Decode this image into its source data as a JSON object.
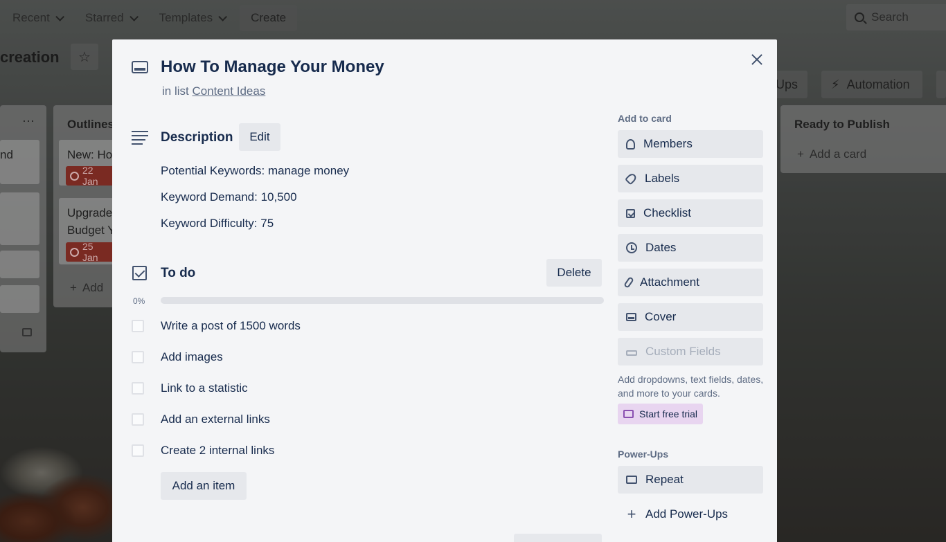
{
  "topbar": {
    "recent": "Recent",
    "starred": "Starred",
    "templates": "Templates",
    "create": "Create",
    "search": "Search"
  },
  "board": {
    "title": "creation",
    "powerups_btn": "-Ups",
    "automation_btn": "Automation",
    "left_list": {
      "menu": "···",
      "card1": "nd"
    },
    "outlines_list": {
      "title": "Outlines",
      "card1": "New: Ho",
      "card1_due": "22 Jan",
      "card2_line1": "Upgrade",
      "card2_line2": "Budget Y",
      "card2_due": "25 Jan",
      "add": "Add"
    },
    "ready_list": {
      "title": "Ready to Publish",
      "add": "Add a card"
    }
  },
  "card": {
    "title": "How To Manage Your Money",
    "in_list_prefix": "in list",
    "list_name": "Content Ideas"
  },
  "description": {
    "title": "Description",
    "edit": "Edit",
    "lines": [
      "Potential Keywords: manage money",
      "Keyword Demand: 10,500",
      "Keyword Difficulty: 75"
    ]
  },
  "checklist": {
    "title": "To do",
    "delete": "Delete",
    "percent": "0%",
    "progress": 0,
    "items": [
      "Write a post of 1500 words",
      "Add images",
      "Link to a statistic",
      "Add an external links",
      "Create 2 internal links"
    ],
    "add_item": "Add an item"
  },
  "sidebar": {
    "add_to_card": "Add to card",
    "buttons": {
      "members": "Members",
      "labels": "Labels",
      "checklist": "Checklist",
      "dates": "Dates",
      "attachment": "Attachment",
      "cover": "Cover",
      "custom_fields": "Custom Fields"
    },
    "custom_fields_note": "Add dropdowns, text fields, dates, and more to your cards.",
    "start_trial": "Start free trial",
    "powerups_heading": "Power-Ups",
    "repeat": "Repeat",
    "add_powerups": "Add Power-Ups"
  },
  "colors": {
    "modal_bg": "#f4f5f7",
    "button_bg": "#e6e8ec",
    "text": "#172b4d",
    "subtle": "#5e6c84",
    "trial_bg": "#e8d5f0",
    "due_red": "#7a2a22"
  }
}
